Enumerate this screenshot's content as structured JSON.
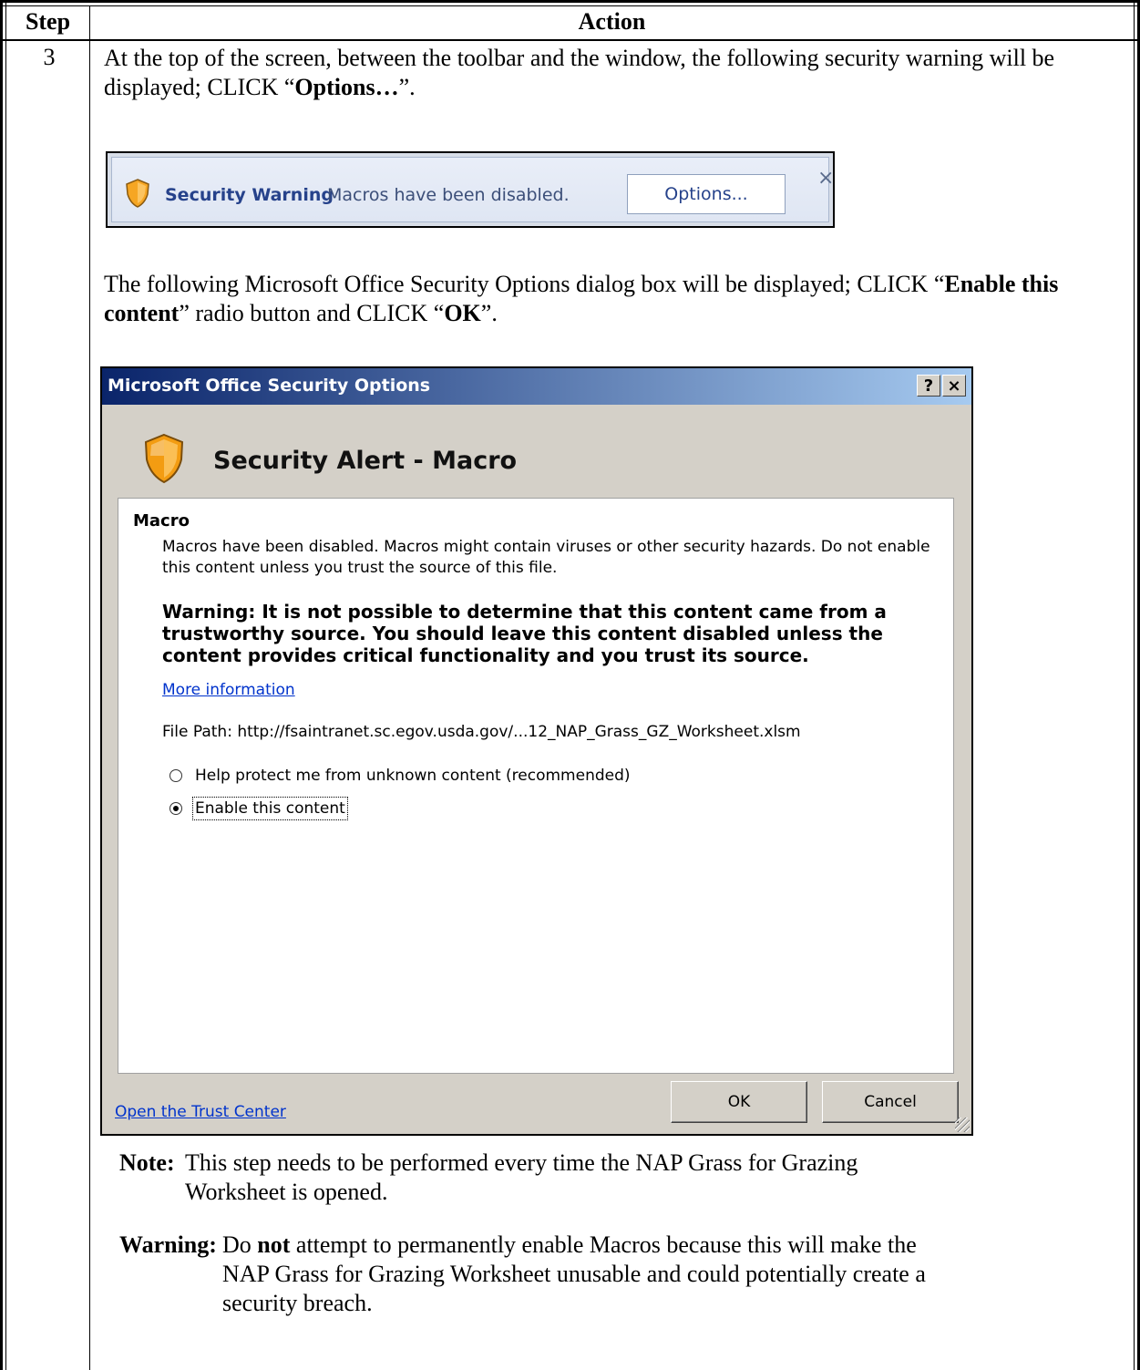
{
  "table": {
    "header_step": "Step",
    "header_action": "Action",
    "step_number": "3"
  },
  "intro": {
    "part1": "At the top of the screen, between the toolbar and the window, the following security warning will be displayed; CLICK “",
    "bold": "Options…",
    "part2": "”."
  },
  "warning_bar": {
    "title": "Security Warning",
    "message": "Macros have been disabled.",
    "options_button": "Options...",
    "close": "×"
  },
  "mid_text": {
    "part1": "The following Microsoft Office Security Options dialog box will be displayed; CLICK “",
    "bold1": "Enable this content",
    "part2": "” radio button and CLICK “",
    "bold2": "OK",
    "part3": "”."
  },
  "dialog": {
    "title": "Microsoft Office Security Options",
    "help_button": "?",
    "close_button": "×",
    "heading": "Security Alert - Macro",
    "section_label": "Macro",
    "description": "Macros have been disabled. Macros might contain viruses or other security hazards. Do not enable this content unless you trust the source of this file.",
    "warning": "Warning: It is not possible to determine that this content came from a trustworthy source. You should leave this content disabled unless the content provides critical functionality and you trust its source.",
    "more_info": "More information",
    "file_path": "File Path:   http://fsaintranet.sc.egov.usda.gov/...12_NAP_Grass_GZ_Worksheet.xlsm",
    "radio_protect": "Help protect me from unknown content (recommended)",
    "radio_enable": "Enable this content",
    "trust_center_link": "Open the Trust Center",
    "ok_button": "OK",
    "cancel_button": "Cancel"
  },
  "note": {
    "label": "Note:",
    "text1": "This step needs to be performed every time the NAP Grass for Grazing",
    "text2": "Worksheet is opened."
  },
  "final_warning": {
    "label": "Warning:",
    "pre": "Do ",
    "bold": "not",
    "post": " attempt to permanently enable Macros because this will make the",
    "line2": "NAP Grass for Grazing Worksheet unusable and could potentially create a",
    "line3": "security breach."
  },
  "colors": {
    "warning_bar_text": "#26428b",
    "dialog_titlebar": "#0a246a",
    "dialog_bg": "#d4d0c8",
    "link": "#0033cc",
    "shield_orange": "#f5a623"
  }
}
